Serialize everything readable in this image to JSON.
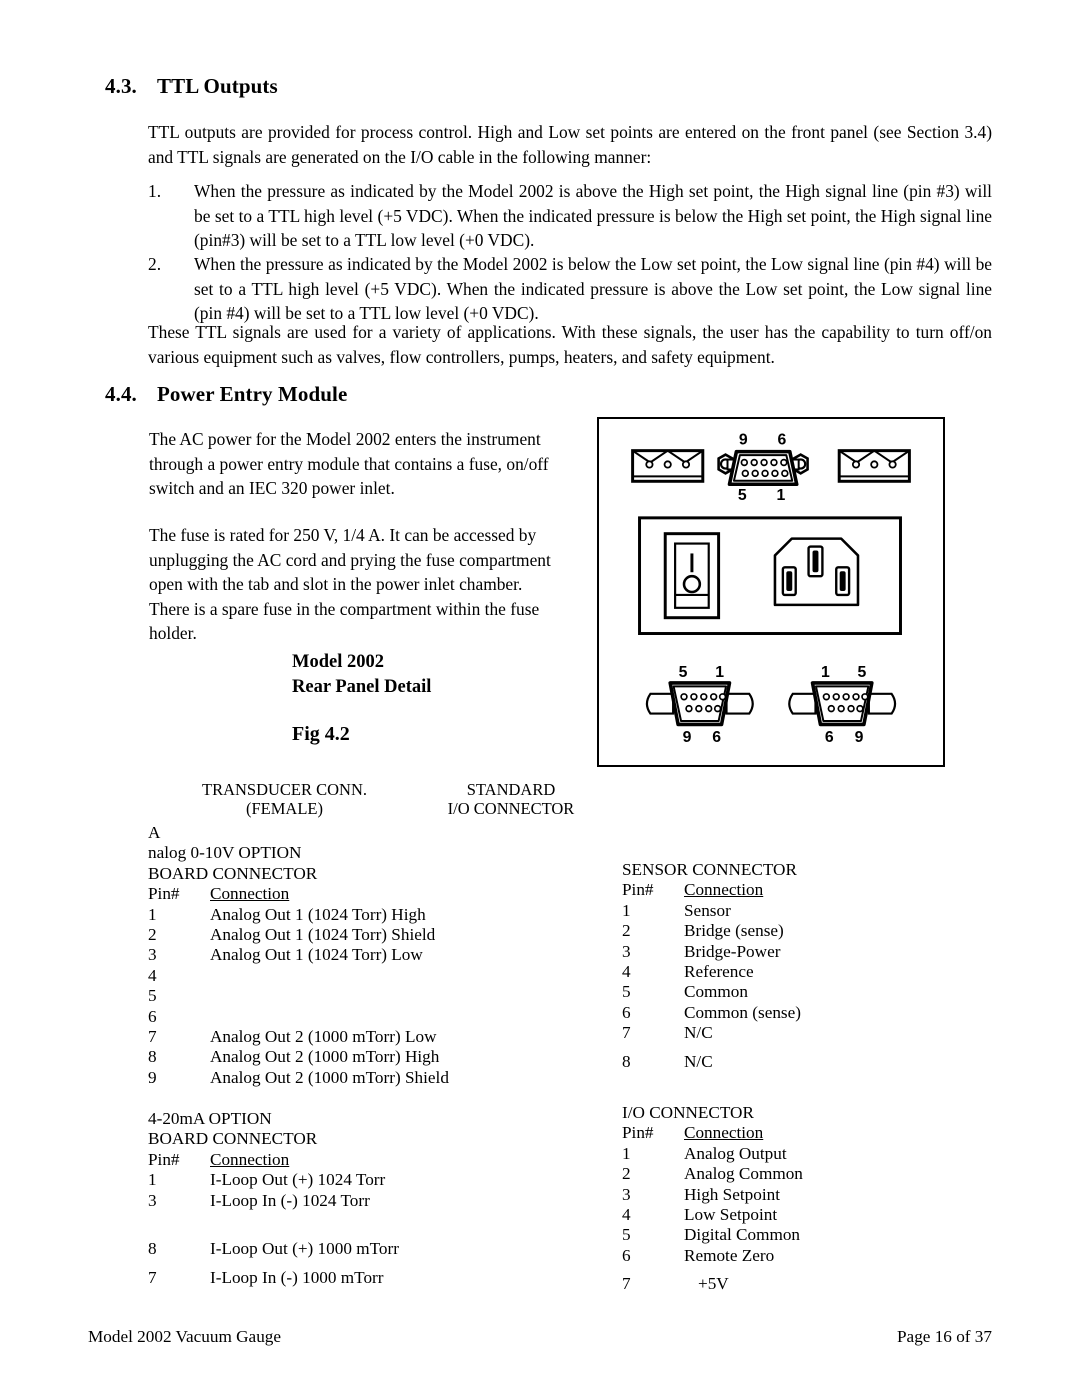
{
  "sections": {
    "ttl": {
      "number": "4.3.",
      "title": "TTL Outputs",
      "intro": "TTL outputs are provided for process control.  High and Low set points are entered on the front panel (see Section 3.4) and TTL signals are generated on the I/O cable in the following manner:",
      "items": [
        {
          "marker": "1.",
          "text": "When the pressure as indicated by the Model 2002 is above the High set point, the High signal line (pin #3) will be set to a TTL high level (+5 VDC).  When the indicated pressure is below the High set point, the High signal line (pin#3) will be set to a TTL low level (+0 VDC)."
        },
        {
          "marker": "2.",
          "text": "When the pressure as indicated by the Model 2002 is below the Low set point, the Low signal line (pin #4) will be set to a TTL high level (+5 VDC).  When the indicated pressure is above the Low set point, the Low signal line (pin #4) will be set to a TTL low level (+0 VDC)."
        }
      ],
      "closing": "These TTL signals are used for a variety of applications.  With these signals, the user has the capability to turn off/on various equipment such as valves, flow controllers, pumps, heaters, and safety equipment."
    },
    "power": {
      "number": "4.4.",
      "title": "Power Entry Module",
      "para1": "The AC power for the Model 2002 enters the instrument through a power entry module that contains a fuse, on/off switch and an IEC 320 power inlet.",
      "para2": "The fuse is rated for 250 V, 1/4 A. It can be accessed by unplugging the AC cord and prying the fuse compartment open with the tab and slot in the power inlet chamber.  There is a spare fuse in the compartment within the fuse holder."
    }
  },
  "figure": {
    "caption_line1": "Model 2002",
    "caption_line2": "Rear Panel Detail",
    "caption_fig": "Fig 4.2",
    "db9_top": {
      "tl": "9",
      "tr": "6",
      "bl": "5",
      "br": "1"
    },
    "db9_bottom_left": {
      "tl": "5",
      "tr": "1",
      "bl": "9",
      "br": "6"
    },
    "db9_bottom_right": {
      "tl": "1",
      "tr": "5",
      "bl": "6",
      "br": "9"
    }
  },
  "column_headers": {
    "left_line1": "TRANSDUCER CONN.",
    "left_line2": "(FEMALE)",
    "right_line1": "STANDARD",
    "right_line2": "I/O CONNECTOR"
  },
  "tables": {
    "analog": {
      "title_line1": "A",
      "title_line2": "nalog 0-10V OPTION",
      "title_line3": "BOARD CONNECTOR",
      "header": {
        "pin": "Pin#",
        "conn": "Connection"
      },
      "rows": [
        {
          "pin": "1",
          "conn": "Analog Out 1 (1024 Torr) High"
        },
        {
          "pin": "2",
          "conn": "Analog Out 1 (1024 Torr) Shield"
        },
        {
          "pin": "3",
          "conn": "Analog Out 1 (1024 Torr) Low"
        },
        {
          "pin": "4",
          "conn": ""
        },
        {
          "pin": "5",
          "conn": ""
        },
        {
          "pin": "6",
          "conn": ""
        },
        {
          "pin": "7",
          "conn": "Analog Out 2 (1000 mTorr) Low"
        },
        {
          "pin": "8",
          "conn": "Analog Out 2 (1000 mTorr) High"
        },
        {
          "pin": "9",
          "conn": "Analog Out 2 (1000 mTorr) Shield"
        }
      ]
    },
    "current_loop": {
      "title_line1": "4-20mA OPTION",
      "title_line2": "BOARD CONNECTOR",
      "header": {
        "pin": "Pin#",
        "conn": "Connection"
      },
      "rows": [
        {
          "pin": "1",
          "conn": "I-Loop Out (+) 1024 Torr"
        },
        {
          "pin": "3",
          "conn": "I-Loop In   (-)  1024 Torr"
        },
        {
          "pin": "",
          "conn": ""
        },
        {
          "pin": "8",
          "conn": "I-Loop Out (+) 1000 mTorr"
        },
        {
          "pin": "7",
          "conn": "I-Loop In  (-) 1000 mTorr"
        }
      ]
    },
    "sensor": {
      "title_line1": "SENSOR CONNECTOR",
      "header": {
        "pin": "Pin#",
        "conn": "Connection"
      },
      "rows": [
        {
          "pin": "1",
          "conn": "Sensor"
        },
        {
          "pin": "2",
          "conn": "Bridge (sense)"
        },
        {
          "pin": "3",
          "conn": "Bridge-Power"
        },
        {
          "pin": "4",
          "conn": "Reference"
        },
        {
          "pin": "5",
          "conn": "Common"
        },
        {
          "pin": "6",
          "conn": "Common (sense)"
        },
        {
          "pin": "7",
          "conn": "N/C"
        },
        {
          "pin": "8",
          "conn": "N/C"
        }
      ]
    },
    "io": {
      "title_line1": "I/O CONNECTOR",
      "header": {
        "pin": "Pin#",
        "conn": "Connection"
      },
      "rows": [
        {
          "pin": "1",
          "conn": "Analog Output"
        },
        {
          "pin": "2",
          "conn": "Analog Common"
        },
        {
          "pin": "3",
          "conn": "High Setpoint"
        },
        {
          "pin": "4",
          "conn": "Low Setpoint"
        },
        {
          "pin": "5",
          "conn": "Digital Common"
        },
        {
          "pin": "6",
          "conn": "Remote Zero"
        },
        {
          "pin": "7",
          "conn": "+5V"
        }
      ]
    }
  },
  "footer": {
    "left": "Model 2002 Vacuum Gauge",
    "right": "Page 16 of 37"
  },
  "colors": {
    "ink": "#000000",
    "paper": "#ffffff"
  }
}
